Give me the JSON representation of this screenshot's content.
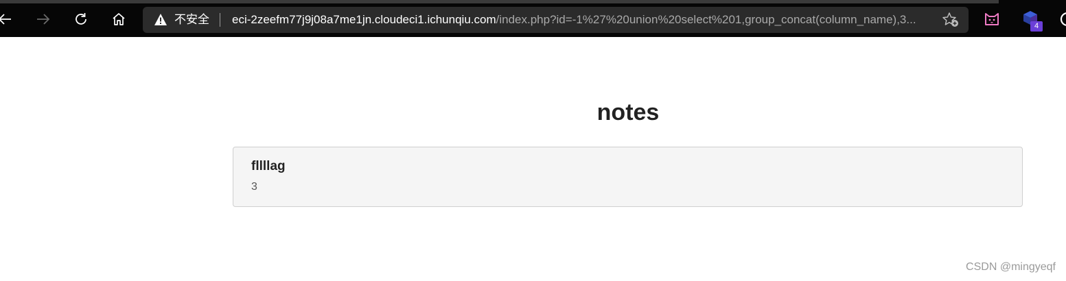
{
  "browser": {
    "security_label": "不安全",
    "url_host": "eci-2zeefm77j9j08a7me1jn.cloudeci1.ichunqiu.com",
    "url_path": "/index.php?id=-1%27%20union%20select%201,group_concat(column_name),3...",
    "extension_badge": "4",
    "icons": {
      "back": "back-arrow-icon",
      "forward": "forward-arrow-icon",
      "reload": "reload-icon",
      "home": "home-icon",
      "warning": "warning-icon",
      "favorite": "add-favorite-icon",
      "extension_cat": "cat-extension-icon",
      "extension_box": "box-extension-icon",
      "profile": "profile-icon"
    },
    "colors": {
      "toolbar_bg": "#060606",
      "address_bg": "#2b2b2b",
      "url_host": "#ffffff",
      "url_path": "#a9a9a9",
      "cat_icon": "#f07bc5",
      "badge": "#6b3fd8"
    }
  },
  "page": {
    "title": "notes",
    "notes": [
      {
        "title": "fllllag",
        "body": "3"
      }
    ]
  },
  "watermark": "CSDN @mingyeqf"
}
